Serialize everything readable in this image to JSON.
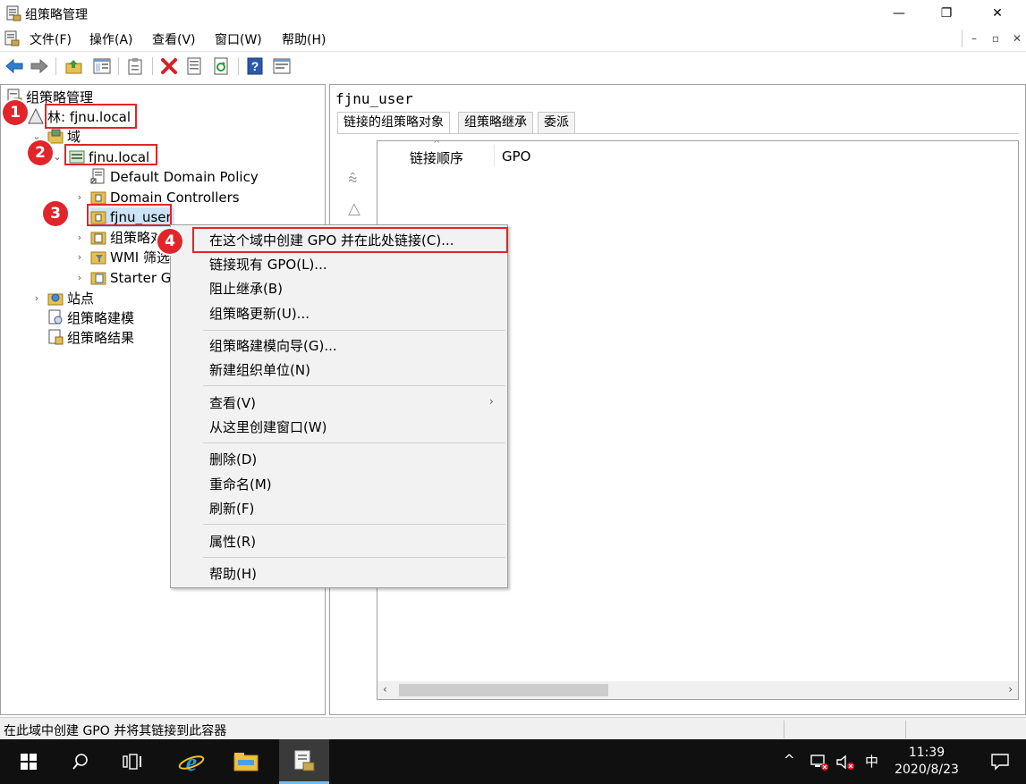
{
  "window": {
    "title": "组策略管理",
    "controls": {
      "minimize": "—",
      "restore": "❐",
      "close": "✕"
    }
  },
  "menubar": {
    "items": [
      "文件(F)",
      "操作(A)",
      "查看(V)",
      "窗口(W)",
      "帮助(H)"
    ],
    "mdi_controls": {
      "minimize": "–",
      "restore": "▫",
      "close": "✕"
    }
  },
  "toolbar": {
    "icons": [
      "back-arrow-icon",
      "forward-arrow-icon",
      "up-folder-icon",
      "show-hide-tree-icon",
      "clipboard-icon",
      "delete-icon",
      "properties-icon",
      "refresh-icon",
      "help-icon",
      "console-icon"
    ]
  },
  "tree": {
    "root": "组策略管理",
    "forest": "林: fjnu.local",
    "domains": "域",
    "domain": "fjnu.local",
    "children": [
      "Default Domain Policy",
      "Domain Controllers",
      "fjnu_user",
      "组策略对",
      "WMI 筛选",
      "Starter GI"
    ],
    "sites": "站点",
    "modeling": "组策略建模",
    "results": "组策略结果"
  },
  "badges": [
    "1",
    "2",
    "3",
    "4"
  ],
  "right_pane": {
    "title": "fjnu_user",
    "tabs": [
      "链接的组策略对象",
      "组策略继承",
      "委派"
    ],
    "columns": [
      "链接顺序",
      "GPO"
    ],
    "sort_arrow": "^"
  },
  "context_menu": {
    "groups": [
      [
        "在这个域中创建 GPO 并在此处链接(C)...",
        "链接现有 GPO(L)...",
        "阻止继承(B)",
        "组策略更新(U)..."
      ],
      [
        "组策略建模向导(G)...",
        "新建组织单位(N)"
      ],
      [
        "查看(V)",
        "从这里创建窗口(W)"
      ],
      [
        "删除(D)",
        "重命名(M)",
        "刷新(F)"
      ],
      [
        "属性(R)"
      ],
      [
        "帮助(H)"
      ]
    ],
    "submenu_arrow": "›"
  },
  "statusbar": {
    "text": "在此域中创建 GPO 并将其链接到此容器"
  },
  "taskbar": {
    "tray": {
      "chevron": "^",
      "ime": "中"
    },
    "clock": {
      "time": "11:39",
      "date": "2020/8/23"
    }
  }
}
